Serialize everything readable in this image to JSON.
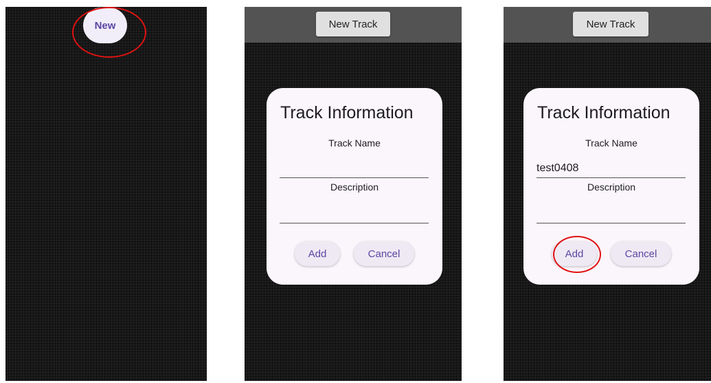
{
  "screen1": {
    "fab_label": "New"
  },
  "screen2": {
    "toolbar_button": "New Track",
    "dialog": {
      "title": "Track Information",
      "name_label": "Track Name",
      "name_value": "",
      "description_label": "Description",
      "description_value": "",
      "add_label": "Add",
      "cancel_label": "Cancel"
    }
  },
  "screen3": {
    "toolbar_button": "New Track",
    "dialog": {
      "title": "Track Information",
      "name_label": "Track Name",
      "name_value": "test0408",
      "description_label": "Description",
      "description_value": "",
      "add_label": "Add",
      "cancel_label": "Cancel"
    }
  },
  "colors": {
    "accent": "#5b46a2",
    "highlight_circle": "#e01212",
    "dialog_bg": "#fbf6fc",
    "toolbar_bg": "#535353"
  }
}
